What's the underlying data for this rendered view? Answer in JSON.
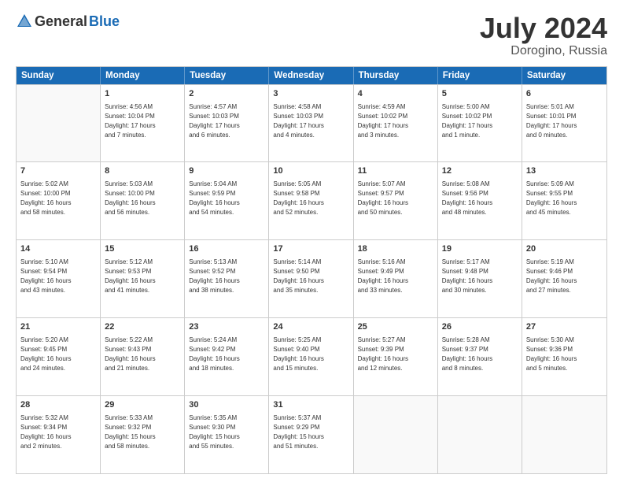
{
  "header": {
    "logo_general": "General",
    "logo_blue": "Blue",
    "title": "July 2024",
    "subtitle": "Dorogino, Russia"
  },
  "days_of_week": [
    "Sunday",
    "Monday",
    "Tuesday",
    "Wednesday",
    "Thursday",
    "Friday",
    "Saturday"
  ],
  "weeks": [
    [
      {
        "day": "",
        "info": ""
      },
      {
        "day": "1",
        "info": "Sunrise: 4:56 AM\nSunset: 10:04 PM\nDaylight: 17 hours\nand 7 minutes."
      },
      {
        "day": "2",
        "info": "Sunrise: 4:57 AM\nSunset: 10:03 PM\nDaylight: 17 hours\nand 6 minutes."
      },
      {
        "day": "3",
        "info": "Sunrise: 4:58 AM\nSunset: 10:03 PM\nDaylight: 17 hours\nand 4 minutes."
      },
      {
        "day": "4",
        "info": "Sunrise: 4:59 AM\nSunset: 10:02 PM\nDaylight: 17 hours\nand 3 minutes."
      },
      {
        "day": "5",
        "info": "Sunrise: 5:00 AM\nSunset: 10:02 PM\nDaylight: 17 hours\nand 1 minute."
      },
      {
        "day": "6",
        "info": "Sunrise: 5:01 AM\nSunset: 10:01 PM\nDaylight: 17 hours\nand 0 minutes."
      }
    ],
    [
      {
        "day": "7",
        "info": "Sunrise: 5:02 AM\nSunset: 10:00 PM\nDaylight: 16 hours\nand 58 minutes."
      },
      {
        "day": "8",
        "info": "Sunrise: 5:03 AM\nSunset: 10:00 PM\nDaylight: 16 hours\nand 56 minutes."
      },
      {
        "day": "9",
        "info": "Sunrise: 5:04 AM\nSunset: 9:59 PM\nDaylight: 16 hours\nand 54 minutes."
      },
      {
        "day": "10",
        "info": "Sunrise: 5:05 AM\nSunset: 9:58 PM\nDaylight: 16 hours\nand 52 minutes."
      },
      {
        "day": "11",
        "info": "Sunrise: 5:07 AM\nSunset: 9:57 PM\nDaylight: 16 hours\nand 50 minutes."
      },
      {
        "day": "12",
        "info": "Sunrise: 5:08 AM\nSunset: 9:56 PM\nDaylight: 16 hours\nand 48 minutes."
      },
      {
        "day": "13",
        "info": "Sunrise: 5:09 AM\nSunset: 9:55 PM\nDaylight: 16 hours\nand 45 minutes."
      }
    ],
    [
      {
        "day": "14",
        "info": "Sunrise: 5:10 AM\nSunset: 9:54 PM\nDaylight: 16 hours\nand 43 minutes."
      },
      {
        "day": "15",
        "info": "Sunrise: 5:12 AM\nSunset: 9:53 PM\nDaylight: 16 hours\nand 41 minutes."
      },
      {
        "day": "16",
        "info": "Sunrise: 5:13 AM\nSunset: 9:52 PM\nDaylight: 16 hours\nand 38 minutes."
      },
      {
        "day": "17",
        "info": "Sunrise: 5:14 AM\nSunset: 9:50 PM\nDaylight: 16 hours\nand 35 minutes."
      },
      {
        "day": "18",
        "info": "Sunrise: 5:16 AM\nSunset: 9:49 PM\nDaylight: 16 hours\nand 33 minutes."
      },
      {
        "day": "19",
        "info": "Sunrise: 5:17 AM\nSunset: 9:48 PM\nDaylight: 16 hours\nand 30 minutes."
      },
      {
        "day": "20",
        "info": "Sunrise: 5:19 AM\nSunset: 9:46 PM\nDaylight: 16 hours\nand 27 minutes."
      }
    ],
    [
      {
        "day": "21",
        "info": "Sunrise: 5:20 AM\nSunset: 9:45 PM\nDaylight: 16 hours\nand 24 minutes."
      },
      {
        "day": "22",
        "info": "Sunrise: 5:22 AM\nSunset: 9:43 PM\nDaylight: 16 hours\nand 21 minutes."
      },
      {
        "day": "23",
        "info": "Sunrise: 5:24 AM\nSunset: 9:42 PM\nDaylight: 16 hours\nand 18 minutes."
      },
      {
        "day": "24",
        "info": "Sunrise: 5:25 AM\nSunset: 9:40 PM\nDaylight: 16 hours\nand 15 minutes."
      },
      {
        "day": "25",
        "info": "Sunrise: 5:27 AM\nSunset: 9:39 PM\nDaylight: 16 hours\nand 12 minutes."
      },
      {
        "day": "26",
        "info": "Sunrise: 5:28 AM\nSunset: 9:37 PM\nDaylight: 16 hours\nand 8 minutes."
      },
      {
        "day": "27",
        "info": "Sunrise: 5:30 AM\nSunset: 9:36 PM\nDaylight: 16 hours\nand 5 minutes."
      }
    ],
    [
      {
        "day": "28",
        "info": "Sunrise: 5:32 AM\nSunset: 9:34 PM\nDaylight: 16 hours\nand 2 minutes."
      },
      {
        "day": "29",
        "info": "Sunrise: 5:33 AM\nSunset: 9:32 PM\nDaylight: 15 hours\nand 58 minutes."
      },
      {
        "day": "30",
        "info": "Sunrise: 5:35 AM\nSunset: 9:30 PM\nDaylight: 15 hours\nand 55 minutes."
      },
      {
        "day": "31",
        "info": "Sunrise: 5:37 AM\nSunset: 9:29 PM\nDaylight: 15 hours\nand 51 minutes."
      },
      {
        "day": "",
        "info": ""
      },
      {
        "day": "",
        "info": ""
      },
      {
        "day": "",
        "info": ""
      }
    ]
  ]
}
